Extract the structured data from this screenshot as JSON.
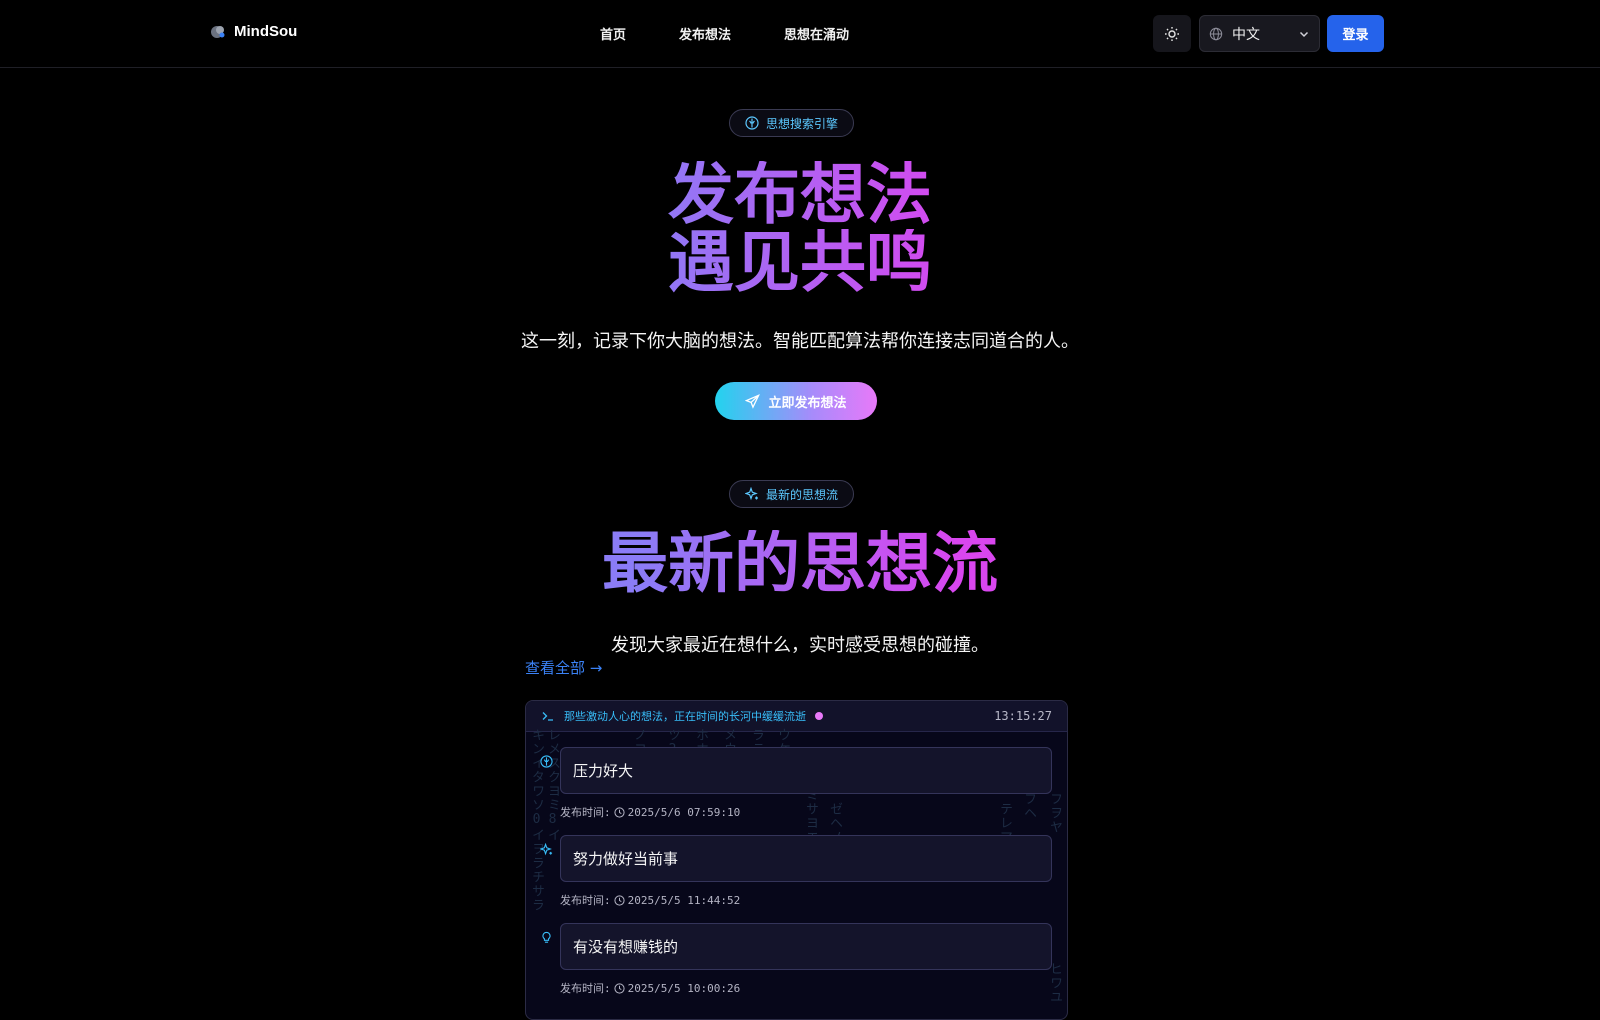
{
  "nav": {
    "brand": "MindSou",
    "links": [
      "首页",
      "发布想法",
      "思想在涌动"
    ],
    "language": "中文",
    "login_label": "登录"
  },
  "hero": {
    "badge": "思想搜索引擎",
    "title_line1": "发布想法",
    "title_line2": "遇见共鸣",
    "subtitle": "这一刻，记录下你大脑的想法。智能匹配算法帮你连接志同道合的人。",
    "cta_label": "立即发布想法"
  },
  "latest": {
    "badge": "最新的思想流",
    "title": "最新的思想流",
    "subtitle": "发现大家最近在想什么，实时感受思想的碰撞。",
    "view_all": "查看全部 →"
  },
  "terminal": {
    "header_text": "那些激动人心的想法，正在时间的长河中缓缓流逝",
    "clock": "13:15:27",
    "time_label": "发布时间:",
    "thoughts": [
      {
        "icon": "brain-icon",
        "text": "压力好大",
        "time": "2025/5/6 07:59:10"
      },
      {
        "icon": "sparkle-icon",
        "text": "努力做好当前事",
        "time": "2025/5/5 11:44:52"
      },
      {
        "icon": "lightbulb-icon",
        "text": "有没有想赚钱的",
        "time": "2025/5/5 10:00:26"
      }
    ]
  },
  "colors": {
    "accent_blue": "#2563eb",
    "cyan": "#38bdf8",
    "violet": "#8b7cf6",
    "magenta": "#d946ef"
  }
}
